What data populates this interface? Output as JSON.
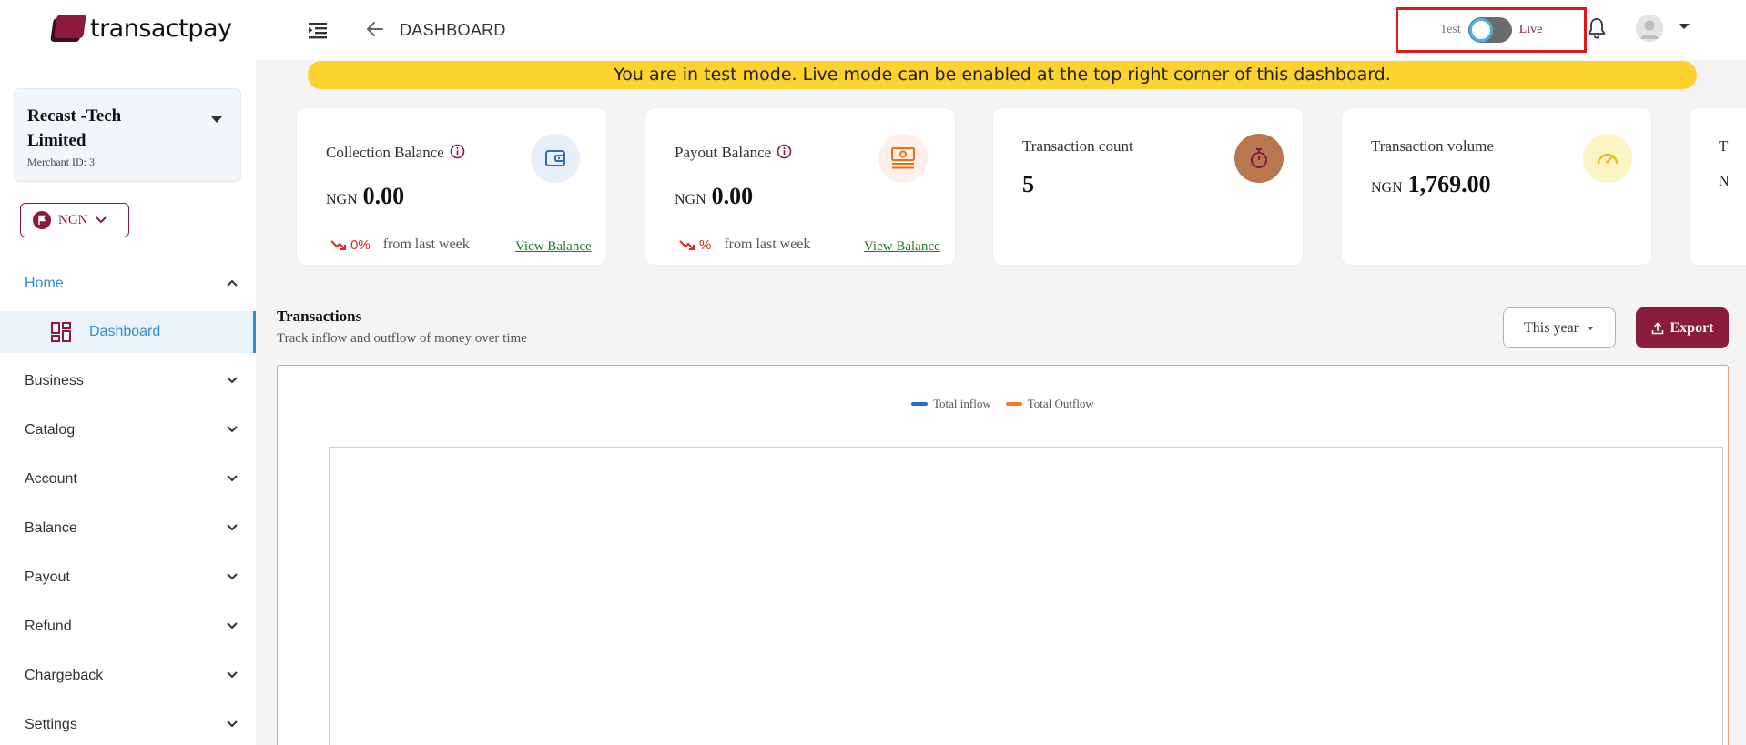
{
  "brand": {
    "name": "transactpay"
  },
  "header": {
    "breadcrumb": "DASHBOARD",
    "mode_test_label": "Test",
    "mode_live_label": "Live",
    "mode_is_live": false
  },
  "banner": {
    "text": "You are in test mode. Live mode can be enabled at the top right corner of this dashboard."
  },
  "merchant": {
    "name": "Recast -Tech Limited",
    "id_label": "Merchant ID: 3"
  },
  "currency": {
    "label": "NGN"
  },
  "sidebar": {
    "items": [
      {
        "label": "Home",
        "expanded": true
      },
      {
        "label": "Dashboard",
        "active": true
      },
      {
        "label": "Business"
      },
      {
        "label": "Catalog"
      },
      {
        "label": "Account"
      },
      {
        "label": "Balance"
      },
      {
        "label": "Payout"
      },
      {
        "label": "Refund"
      },
      {
        "label": "Chargeback"
      },
      {
        "label": "Settings"
      }
    ]
  },
  "cards": [
    {
      "title": "Collection Balance",
      "currency": "NGN",
      "amount": "0.00",
      "trend_pct": "0%",
      "trend_text": "from last week",
      "link": "View Balance"
    },
    {
      "title": "Payout Balance",
      "currency": "NGN",
      "amount": "0.00",
      "trend_pct": "%",
      "trend_text": "from last week",
      "link": "View Balance"
    },
    {
      "title": "Transaction count",
      "value": "5"
    },
    {
      "title": "Transaction volume",
      "currency": "NGN",
      "amount": "1,769.00"
    },
    {
      "title": "T",
      "currency": "N"
    }
  ],
  "transactions": {
    "title": "Transactions",
    "subtitle": "Track inflow and outflow of money over time",
    "period": "This year",
    "export_label": "Export"
  },
  "chart_data": {
    "type": "line",
    "series": [
      {
        "name": "Total inflow",
        "color": "#1f6fc4",
        "values": []
      },
      {
        "name": "Total Outflow",
        "color": "#f47b2a",
        "values": []
      }
    ],
    "legend": "top-center"
  },
  "colors": {
    "brand": "#8b1a3d",
    "accent": "#2f8fd3",
    "banner": "#fdd22f",
    "positive": "#1c7a24",
    "negative": "#e0251b"
  },
  "icons": {
    "menu": "menu-collapse-icon",
    "back": "arrow-left-icon",
    "bell": "bell-icon",
    "avatar": "user-avatar-icon",
    "dashboard": "grid-dashboard-icon",
    "wallet": "wallet-icon",
    "cash": "cash-icon",
    "timer": "stopwatch-icon",
    "gauge": "gauge-icon",
    "export": "upload-icon"
  }
}
